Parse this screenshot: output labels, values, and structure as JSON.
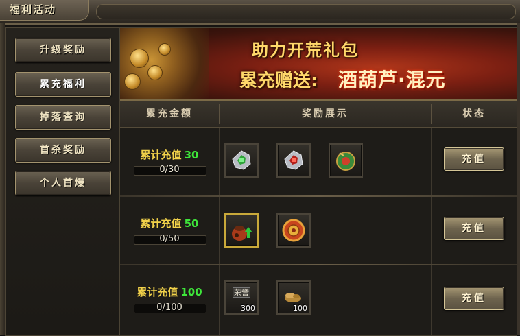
{
  "window": {
    "title": "福利活动"
  },
  "sidebar": {
    "items": [
      {
        "label": "升级奖励"
      },
      {
        "label": "累充福利"
      },
      {
        "label": "掉落查询"
      },
      {
        "label": "首杀奖励"
      },
      {
        "label": "个人首爆"
      }
    ],
    "active_index": 1
  },
  "banner": {
    "line1": "助力开荒礼包",
    "line2_prefix": "累充赠送:",
    "line2_highlight": "酒葫芦·混元"
  },
  "table": {
    "headers": {
      "amount": "累充金额",
      "rewards": "奖励展示",
      "status": "状态"
    },
    "rows": [
      {
        "label": "累计充值",
        "target": "30",
        "progress_text": "0/30",
        "progress": 0,
        "rewards": [
          {
            "icon": "green-gem-icon"
          },
          {
            "icon": "red-gem-icon"
          },
          {
            "icon": "jade-orb-icon"
          }
        ],
        "button": "充值"
      },
      {
        "label": "累计充值",
        "target": "50",
        "progress_text": "0/50",
        "progress": 0,
        "rewards": [
          {
            "icon": "upgrade-pouch-icon"
          },
          {
            "icon": "gold-medal-icon"
          }
        ],
        "button": "充值"
      },
      {
        "label": "累计充值",
        "target": "100",
        "progress_text": "0/100",
        "progress": 0,
        "rewards": [
          {
            "icon": "honor-token-icon",
            "tag": "荣誉",
            "qty": "300"
          },
          {
            "icon": "gold-ingot-icon",
            "qty": "100"
          }
        ],
        "button": "充值"
      }
    ]
  },
  "colors": {
    "label_yellow": "#f2d24a",
    "target_green": "#3ee63a",
    "banner_gold": "#ffd86a"
  }
}
